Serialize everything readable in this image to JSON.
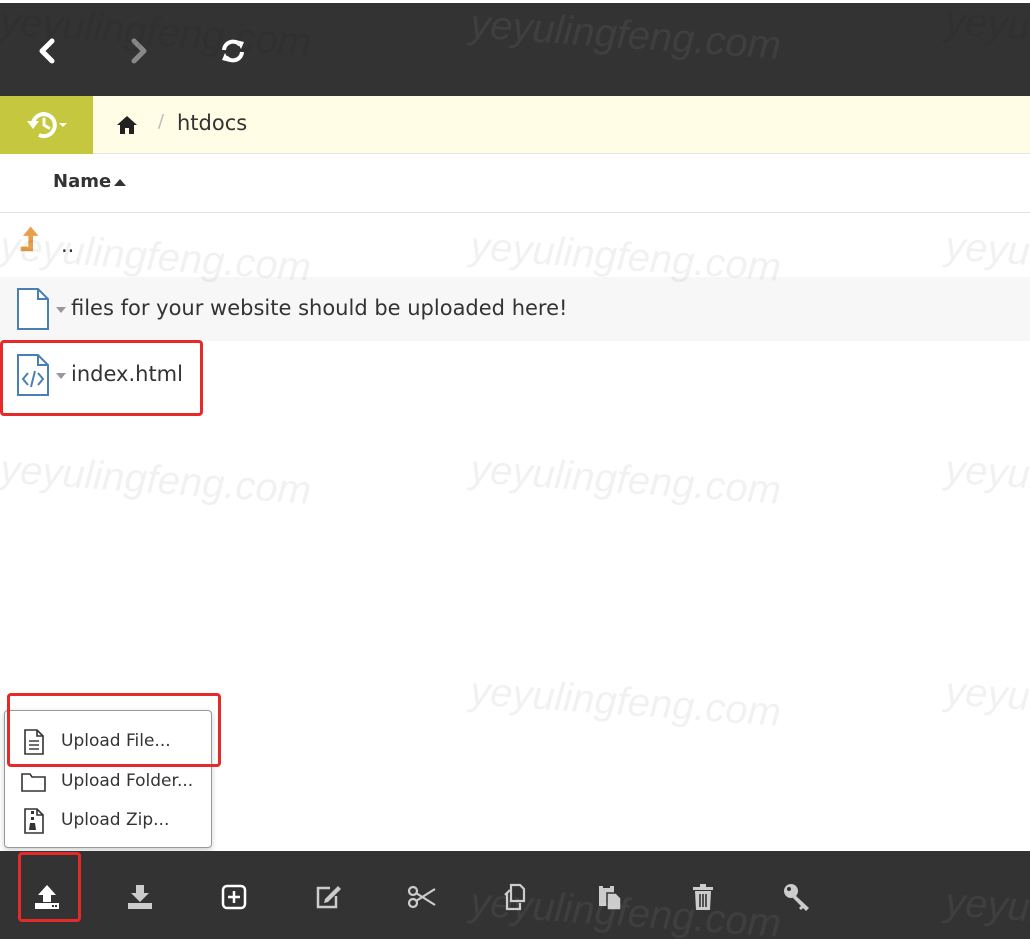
{
  "topbar": {
    "back_icon": "chevron-left-icon",
    "forward_icon": "chevron-right-icon",
    "refresh_icon": "refresh-icon"
  },
  "breadcrumb": {
    "history_icon": "history-icon",
    "home_icon": "home-icon",
    "separator": "/",
    "current": "htdocs"
  },
  "table": {
    "column_name": "Name",
    "sort": "ascending"
  },
  "files": [
    {
      "label": "..",
      "icon": "up-arrow-icon"
    },
    {
      "label": "files for your website should be uploaded here!",
      "icon": "file-icon"
    },
    {
      "label": "index.html",
      "icon": "code-file-icon"
    }
  ],
  "upload_menu": {
    "items": [
      {
        "label": "Upload File...",
        "icon": "file-text-icon"
      },
      {
        "label": "Upload Folder...",
        "icon": "folder-icon"
      },
      {
        "label": "Upload Zip...",
        "icon": "zip-file-icon"
      }
    ]
  },
  "toolbar": {
    "buttons": [
      "upload-icon",
      "download-icon",
      "new-icon",
      "rename-icon",
      "cut-icon",
      "copy-icon",
      "paste-icon",
      "delete-icon",
      "permissions-icon"
    ]
  },
  "watermark": "yeyulingfeng.com",
  "colors": {
    "bar_dark": "#333333",
    "history_green": "#c5c83f",
    "breadcrumb_bg": "#fffde6",
    "highlight_red": "#e52a2a",
    "up_arrow_orange": "#e8a04a",
    "file_icon_blue": "#4a7fb5"
  }
}
